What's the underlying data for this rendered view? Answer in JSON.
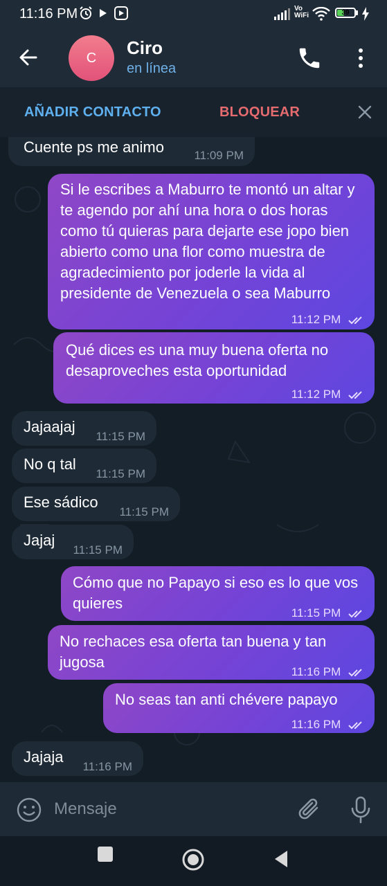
{
  "status_bar": {
    "time": "11:16 PM",
    "network_label": "Vo WiFi",
    "battery": "39",
    "icons": [
      "alarm-icon",
      "play-icon",
      "media-icon",
      "signal-icon",
      "wifi-icon",
      "battery-icon",
      "charging-icon"
    ]
  },
  "header": {
    "avatar_letter": "C",
    "contact_name": "Ciro",
    "status": "en línea",
    "icons": [
      "back-arrow-icon",
      "phone-icon",
      "more-vert-icon"
    ]
  },
  "action_bar": {
    "add_contact": "AÑADIR CONTACTO",
    "block": "BLOQUEAR"
  },
  "messages": [
    {
      "dir": "in",
      "text": "Cuente ps me animo",
      "time": "11:09 PM"
    },
    {
      "dir": "out",
      "text": "Si le escribes a Maburro te montó un altar y te agendo por ahí una hora o dos horas como tú quieras para dejarte ese jopo bien abierto como una flor como muestra de agradecimiento por joderle la vida al presidente de Venezuela o sea Maburro",
      "time": "11:12 PM"
    },
    {
      "dir": "out",
      "text": "Qué dices es una muy buena oferta no desaproveches esta oportunidad",
      "time": "11:12 PM"
    },
    {
      "dir": "in",
      "text": "Jajaajaj",
      "time": "11:15 PM"
    },
    {
      "dir": "in",
      "text": "No q tal",
      "time": "11:15 PM"
    },
    {
      "dir": "in",
      "text": "Ese sádico",
      "time": "11:15 PM"
    },
    {
      "dir": "in",
      "text": "Jajaj",
      "time": "11:15 PM"
    },
    {
      "dir": "out",
      "text": "Cómo que no Papayo si eso es lo que vos quieres",
      "time": "11:15 PM"
    },
    {
      "dir": "out",
      "text": "No rechaces esa oferta tan buena y tan jugosa",
      "time": "11:16 PM"
    },
    {
      "dir": "out",
      "text": "No seas tan anti chévere papayo",
      "time": "11:16 PM"
    },
    {
      "dir": "in",
      "text": "Jajaja",
      "time": "11:16 PM"
    }
  ],
  "input": {
    "placeholder": "Mensaje"
  },
  "colors": {
    "header_bg": "#1f2b36",
    "accent_blue": "#5fb0ee",
    "block_red": "#e56b6f",
    "incoming_bubble": "#1e2a35",
    "outgoing_bubble_start": "#8f47c6",
    "outgoing_bubble_end": "#5d47e0"
  }
}
